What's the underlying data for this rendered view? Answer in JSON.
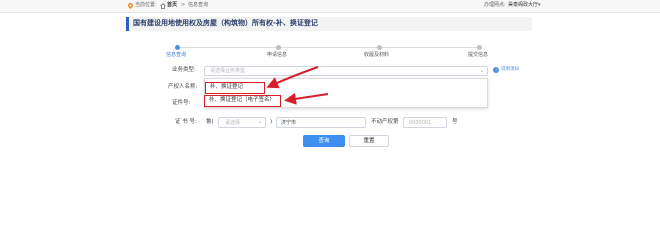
{
  "topbar": {
    "location_label": "当前位置:",
    "home": "首页",
    "separator": ">",
    "current": "信息查询",
    "right_prefix": "办理网点:",
    "right_value": "昊泰阁政大厅",
    "right_suffix": "▾"
  },
  "title": "国有建设用地使用权及房屋（构筑物）所有权-补、换证登记",
  "steps": [
    {
      "label": "信息查询",
      "active": true
    },
    {
      "label": "申请信息",
      "active": false
    },
    {
      "label": "收履及材料",
      "active": false
    },
    {
      "label": "提交信息",
      "active": false
    }
  ],
  "form": {
    "business_type_label": "业务类型:",
    "business_type_placeholder": "请选择业务类型",
    "owner_label": "产权人名称:",
    "cert_no_label": "证件号:",
    "cert_label": "证 书 号:",
    "cert_prefix": "鲁(",
    "cert_year_placeholder": "请选择",
    "cert_close": ")",
    "cert_city": "济宁市",
    "cert_type": "不动产权第",
    "cert_number_placeholder": "0000001",
    "cert_suffix": "号",
    "info_link": "说明须知",
    "info_icon_glyph": "i"
  },
  "dropdown": {
    "items": [
      "补、换证登记",
      "补、换证登记（电子签名）"
    ]
  },
  "buttons": {
    "query": "查询",
    "reset": "重置"
  },
  "colors": {
    "accent": "#3e8ef0",
    "title_border": "#2d5fbf",
    "annotation": "#d6202a"
  }
}
